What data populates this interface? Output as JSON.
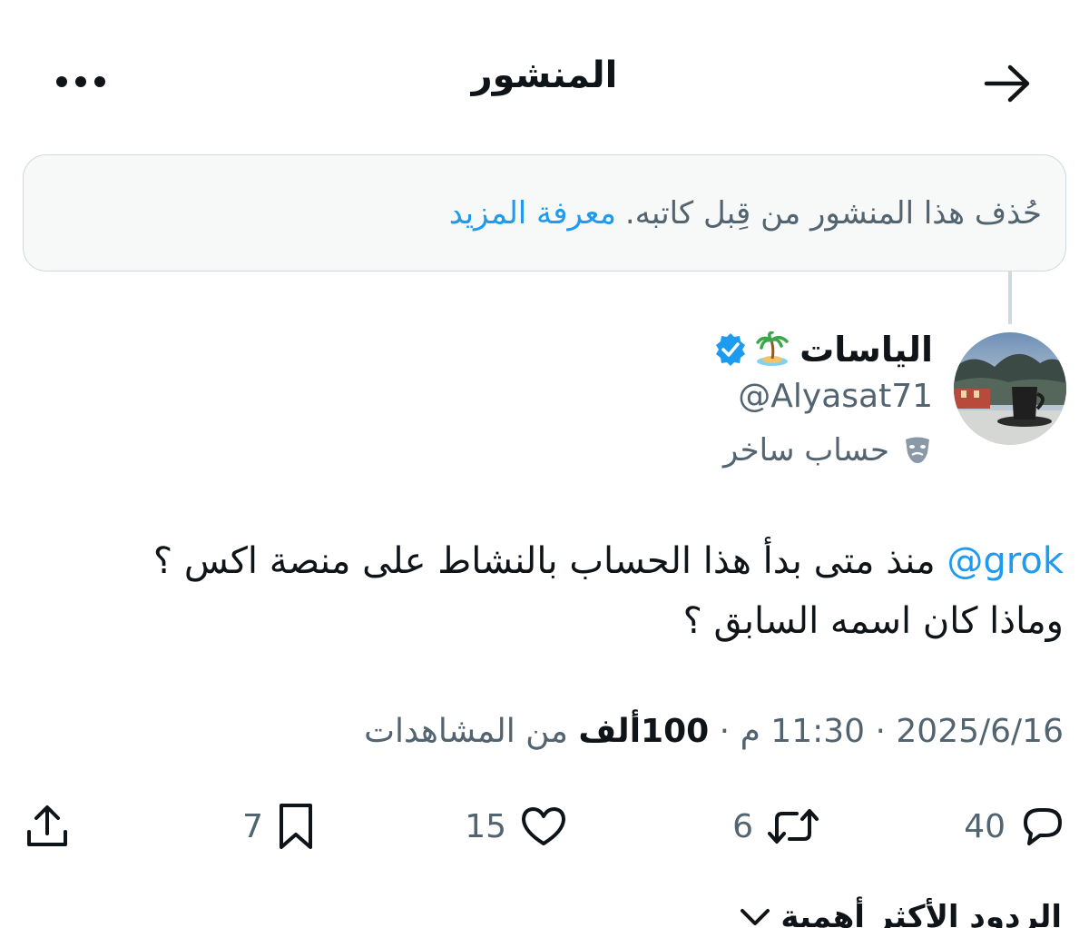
{
  "header": {
    "title": "المنشور",
    "back_icon": "arrow-right-icon",
    "more_icon": "more-horizontal-icon"
  },
  "notice": {
    "text": "حُذف هذا المنشور من قِبل كاتبه.",
    "link": "معرفة المزيد"
  },
  "post": {
    "author": {
      "display_name": "الياسات",
      "emoji_icon": "palm-island-icon",
      "verified_icon": "verified-badge-icon",
      "handle": "@Alyasat71",
      "label_icon": "theater-masks-icon",
      "label": "حساب ساخر"
    },
    "text_mention": "@grok",
    "text_line1": "منذ متى بدأ هذا الحساب بالنشاط على منصة اكس ؟",
    "text_line2": "وماذا كان اسمه السابق ؟",
    "date": "2025/6/16",
    "time": "11:30 م",
    "views_count": "100ألف",
    "views_label": "من المشاهدات",
    "separator": "·"
  },
  "actions": {
    "replies": "40",
    "reposts": "6",
    "likes": "15",
    "bookmarks": "7"
  },
  "replies_sort": {
    "label": "الردود الأكثر أهمية"
  },
  "colors": {
    "accent": "#1d9bf0",
    "text": "#0f1419",
    "muted": "#536471",
    "notice_bg": "#f7f9f9",
    "border": "#cfd9de"
  }
}
